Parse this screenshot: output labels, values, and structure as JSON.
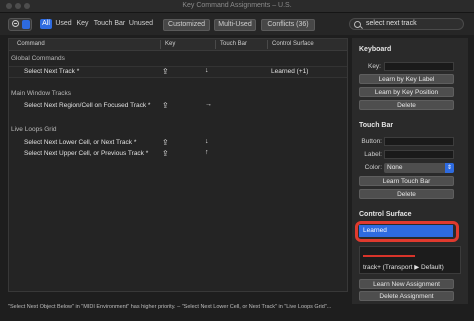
{
  "window": {
    "title": "Key Command Assignments – U.S."
  },
  "toolbar": {
    "filters": [
      "All",
      "Used",
      "Key",
      "Touch Bar",
      "Unused"
    ],
    "customized": "Customized",
    "multi_used": "Multi-Used",
    "conflicts": "Conflicts (36)",
    "search_value": "select next track"
  },
  "table": {
    "columns": {
      "command": "Command",
      "key": "Key",
      "touch_bar": "Touch Bar",
      "control_surface": "Control Surface"
    },
    "groups": [
      {
        "name": "Global Commands",
        "rows": [
          {
            "command": "Select Next Track *",
            "key": "⇪",
            "touch_bar": "↓",
            "control_surface": "Learned (+1)"
          }
        ]
      },
      {
        "name": "Main Window Tracks",
        "rows": [
          {
            "command": "Select Next Region/Cell on Focused Track *",
            "key": "⇪",
            "touch_bar": "→",
            "control_surface": ""
          }
        ]
      },
      {
        "name": "Live Loops Grid",
        "rows": [
          {
            "command": "Select Next Lower Cell, or Next Track *",
            "key": "⇪",
            "touch_bar": "↓",
            "control_surface": ""
          },
          {
            "command": "Select Next Upper Cell, or Previous Track *",
            "key": "⇪",
            "touch_bar": "↑",
            "control_surface": ""
          }
        ]
      }
    ]
  },
  "status_text": "\"Select Next Object Below\" in \"MIDI Environment\" has higher priority. – \"Select Next Lower Cell, or Next Track\" in \"Live Loops Grid\"...",
  "panel": {
    "keyboard": {
      "title": "Keyboard",
      "key_label": "Key:",
      "learn_label_btn": "Learn by Key Label",
      "learn_position_btn": "Learn by Key Position",
      "delete_btn": "Delete"
    },
    "touch_bar": {
      "title": "Touch Bar",
      "button_label": "Button:",
      "label_label": "Label:",
      "color_label": "Color:",
      "color_value": "None",
      "learn_btn": "Learn Touch Bar",
      "delete_btn": "Delete"
    },
    "control_surface": {
      "title": "Control Surface",
      "selected_value": "Learned",
      "assignment_text": "track+ (Transport ▶ Default)",
      "learn_new_btn": "Learn New Assignment",
      "delete_btn": "Delete Assignment"
    }
  },
  "colors": {
    "accent": "#2e6be0",
    "highlight_ring": "#e03a2e"
  }
}
